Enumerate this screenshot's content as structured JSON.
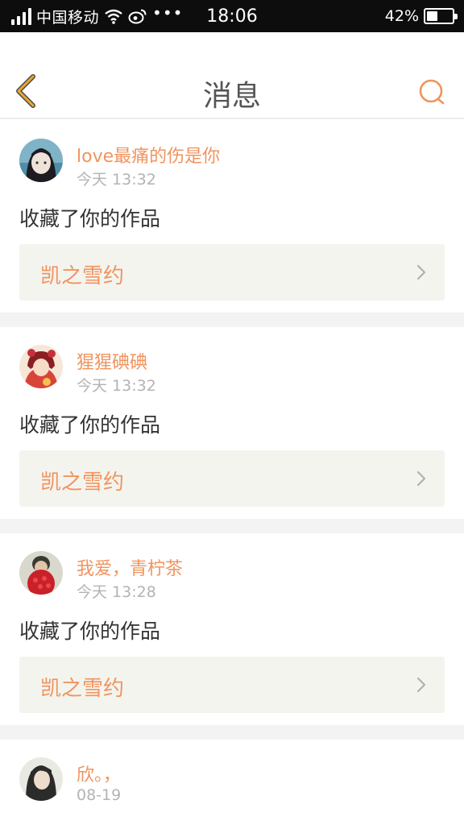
{
  "status_bar": {
    "carrier": "中国移动",
    "more": "•••",
    "time": "18:06",
    "battery_text": "42%",
    "battery_level": 0.42
  },
  "header": {
    "title": "消息",
    "back_icon": "chevron-left-icon",
    "search_icon": "search-icon"
  },
  "messages": [
    {
      "username": "love最痛的伤是你",
      "time": "今天 13:32",
      "action": "收藏了你的作品",
      "work_title": "凯之雪约"
    },
    {
      "username": "猩猩碘碘",
      "time": "今天 13:32",
      "action": "收藏了你的作品",
      "work_title": "凯之雪约"
    },
    {
      "username": "我爱，青柠茶",
      "time": "今天 13:28",
      "action": "收藏了你的作品",
      "work_title": "凯之雪约"
    },
    {
      "username": "欣。，",
      "time": "08-19"
    }
  ],
  "colors": {
    "accent": "#f0945e",
    "back_icon": "#e8a92e",
    "status_bar_bg": "#0d0d0d",
    "link_bg": "#f4f4ef",
    "separator": "#f3f3f3"
  }
}
